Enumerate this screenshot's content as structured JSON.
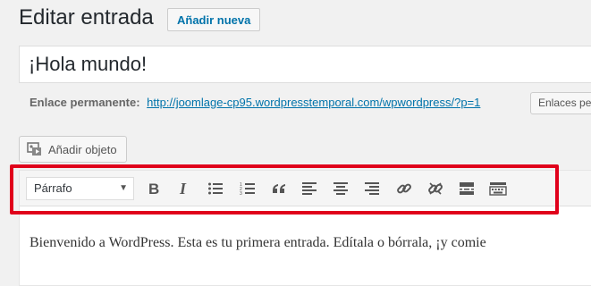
{
  "header": {
    "title": "Editar entrada",
    "add_new_label": "Añadir nueva"
  },
  "post": {
    "title": "¡Hola mundo!"
  },
  "permalink": {
    "label": "Enlace permanente:",
    "url": "http://joomlage-cp95.wordpresstemporal.com/wpwordpress/?p=1",
    "button_label": "Enlaces pern"
  },
  "media": {
    "button_label": "Añadir objeto",
    "icon": "media-icon"
  },
  "toolbar": {
    "format_selected": "Párrafo",
    "buttons": [
      "bold-icon",
      "italic-icon",
      "bulleted-list-icon",
      "numbered-list-icon",
      "blockquote-icon",
      "align-left-icon",
      "align-center-icon",
      "align-right-icon",
      "insert-link-icon",
      "remove-link-icon",
      "read-more-icon",
      "toolbar-toggle-icon"
    ],
    "highlight_color": "#e0001b"
  },
  "content": {
    "text": "Bienvenido a WordPress. Esta es tu primera entrada. Edítala o bórrala, ¡y comie"
  }
}
